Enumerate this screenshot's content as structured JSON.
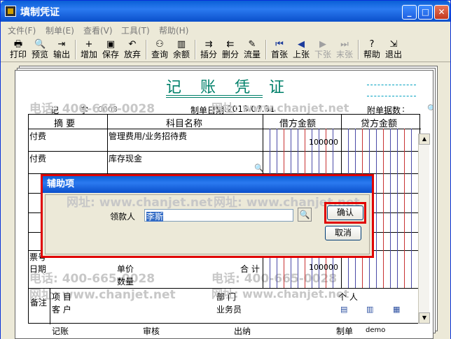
{
  "window": {
    "title": "填制凭证",
    "min": "_",
    "max": "□",
    "close": "✕"
  },
  "menu": [
    "文件(F)",
    "制单(E)",
    "查看(V)",
    "工具(T)",
    "帮助(H)"
  ],
  "toolbar": [
    {
      "label": "打印",
      "icon": "printer-icon",
      "glyph": "🖶"
    },
    {
      "label": "预览",
      "icon": "preview-icon",
      "glyph": "🔍"
    },
    {
      "label": "输出",
      "icon": "export-icon",
      "glyph": "⇥"
    },
    {
      "label": "增加",
      "icon": "add-icon",
      "glyph": "+"
    },
    {
      "label": "保存",
      "icon": "save-icon",
      "glyph": "▣"
    },
    {
      "label": "放弃",
      "icon": "undo-icon",
      "glyph": "↶"
    },
    {
      "label": "查询",
      "icon": "binoculars-icon",
      "glyph": "⚇"
    },
    {
      "label": "余额",
      "icon": "balance-chart-icon",
      "glyph": "▥"
    },
    {
      "label": "插分",
      "icon": "insert-row-icon",
      "glyph": "⇉"
    },
    {
      "label": "删分",
      "icon": "delete-row-icon",
      "glyph": "⇇"
    },
    {
      "label": "流量",
      "icon": "cashflow-icon",
      "glyph": "✎"
    },
    {
      "label": "首张",
      "icon": "first-icon",
      "glyph": "⏮"
    },
    {
      "label": "上张",
      "icon": "prev-icon",
      "glyph": "◀"
    },
    {
      "label": "下张",
      "icon": "next-icon",
      "glyph": "▶"
    },
    {
      "label": "末张",
      "icon": "last-icon",
      "glyph": "⏭"
    },
    {
      "label": "帮助",
      "icon": "help-icon",
      "glyph": "?"
    },
    {
      "label": "退出",
      "icon": "exit-icon",
      "glyph": "⇲"
    }
  ],
  "voucher": {
    "title": "记 账 凭 证",
    "type_label": "记",
    "zi": "字",
    "number": "0003",
    "date_label": "制单日期",
    "date": ":2013.07.31",
    "attach_label": "附单据数",
    "attach_colon": ":",
    "col_summary": "摘 要",
    "col_account": "科目名称",
    "col_debit": "借方金额",
    "col_credit": "贷方金额",
    "rows": [
      {
        "summary": "付费",
        "account": "管理费用/业务招待费",
        "debit": "100000"
      },
      {
        "summary": "付费",
        "account": "库存现金",
        "debit": ""
      }
    ],
    "ticket_label": "票号",
    "date2_label": "日期",
    "price_label": "单价",
    "qty_label": "数量",
    "total_label": "合 计",
    "total_debit": "100000",
    "notes_label": "备注",
    "project_label": "项  目",
    "dept_label": "部  门",
    "person_label": "个  人",
    "customer_label": "客  户",
    "salesman_label": "业务员",
    "bookkeeping_label": "记账",
    "audit_label": "审核",
    "cashier_label": "出纳",
    "maker_label": "制单",
    "maker_value": "demo"
  },
  "watermarks": [
    "电话: 400-665-0028",
    "网址: www.chanjet.net",
    "电话: 400-665-0028",
    "网址: www.chanjet.net"
  ],
  "dialog": {
    "title": "辅助项",
    "payee_label": "领款人",
    "payee_value": "李斯",
    "ok_label": "确认",
    "cancel_label": "取消"
  }
}
